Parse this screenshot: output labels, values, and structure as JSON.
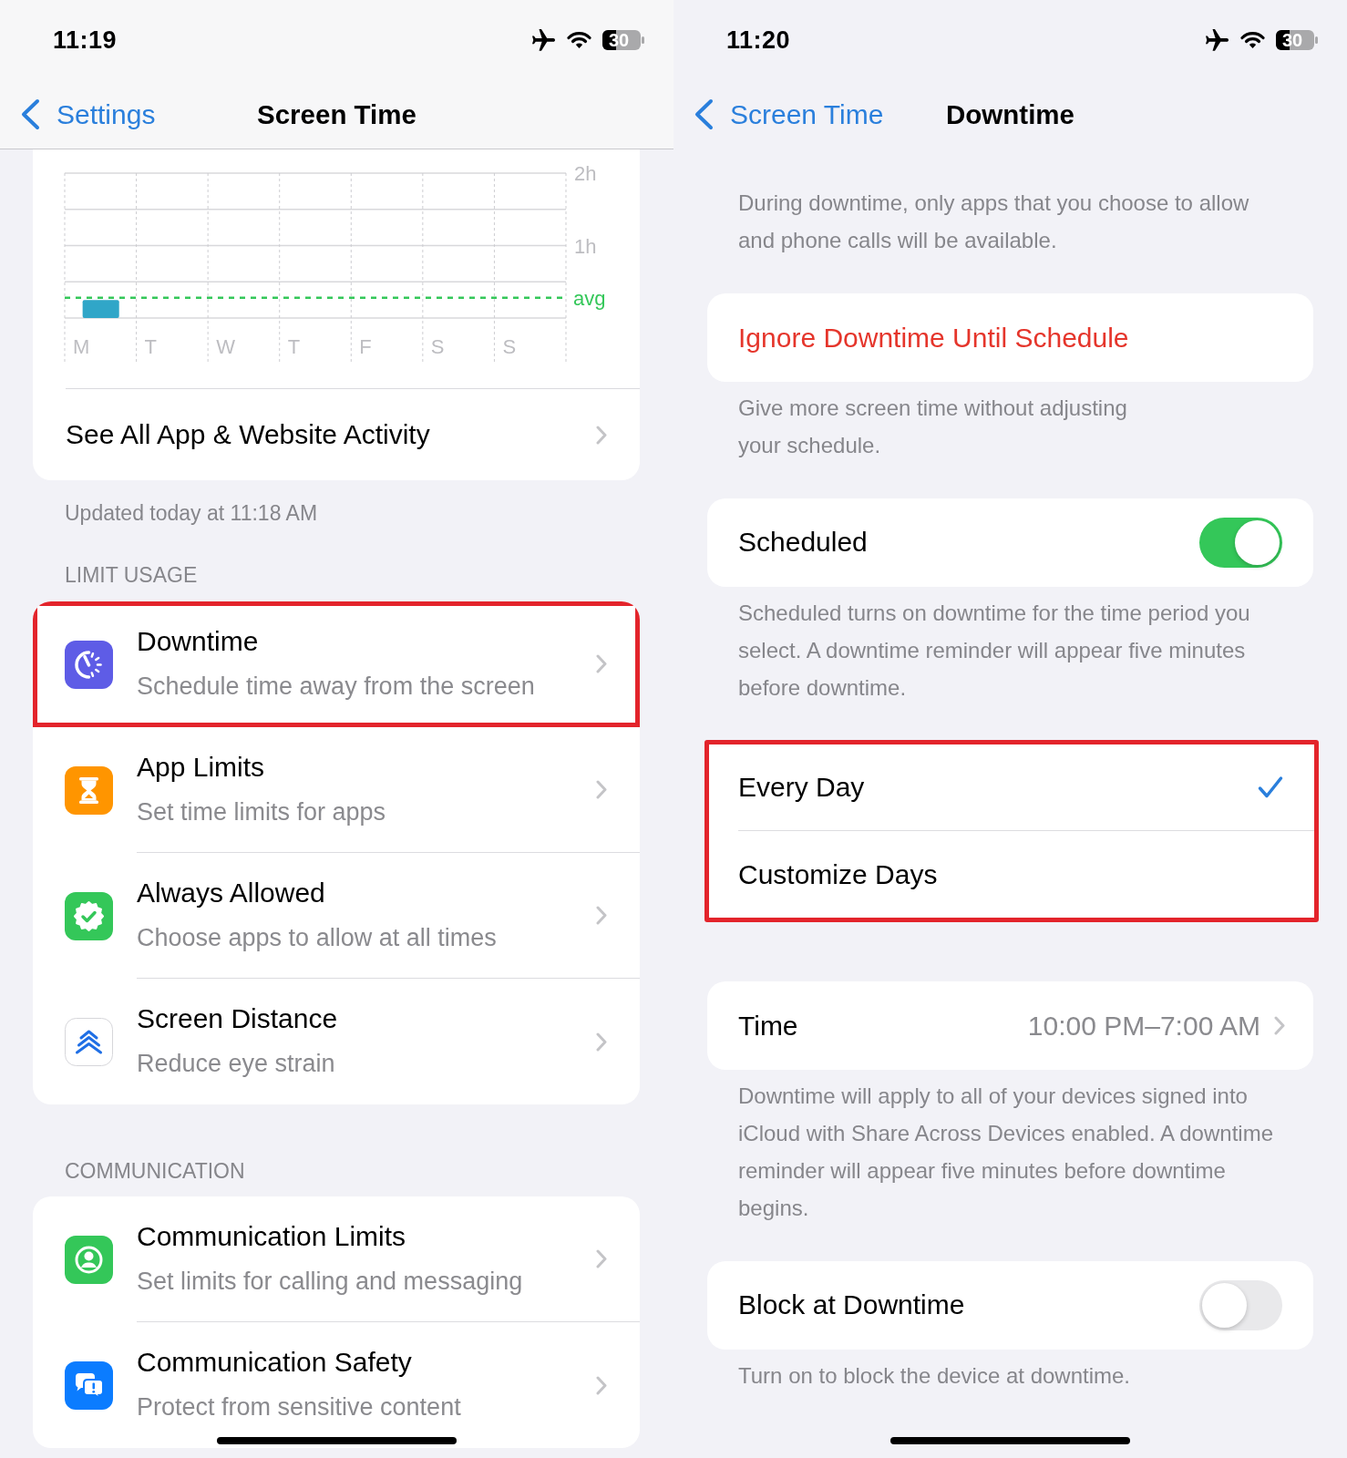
{
  "screen_time_page": {
    "status_bar": {
      "time": "11:19",
      "battery": "30"
    },
    "nav_bar": {
      "back": "Settings",
      "title": "Screen Time"
    },
    "activity_card": {
      "chart_data": {
        "type": "bar",
        "categories": [
          "M",
          "T",
          "W",
          "T",
          "F",
          "S",
          "S"
        ],
        "values": [
          0.25,
          null,
          null,
          null,
          null,
          null,
          null
        ],
        "ylim": [
          0,
          2
        ],
        "yticks": [
          {
            "value": 1,
            "label": "1h"
          },
          {
            "value": 2,
            "label": "2h"
          }
        ],
        "ref_lines": [
          {
            "axis": "y",
            "value": 0.28,
            "label": "avg"
          }
        ]
      },
      "link": "See All App & Website Activity"
    },
    "updated_note": "Updated today at 11:18 AM",
    "sections": [
      {
        "header": "LIMIT USAGE",
        "rows": [
          {
            "title": "Downtime",
            "subtitle": "Schedule time away from the screen",
            "highlighted": true
          },
          {
            "title": "App Limits",
            "subtitle": "Set time limits for apps",
            "highlighted": false
          },
          {
            "title": "Always Allowed",
            "subtitle": "Choose apps to allow at all times",
            "highlighted": false
          },
          {
            "title": "Screen Distance",
            "subtitle": "Reduce eye strain",
            "highlighted": false
          }
        ]
      },
      {
        "header": "COMMUNICATION",
        "rows": [
          {
            "title": "Communication Limits",
            "subtitle": "Set limits for calling and messaging",
            "highlighted": false
          },
          {
            "title": "Communication Safety",
            "subtitle": "Protect from sensitive content",
            "highlighted": false
          }
        ]
      }
    ]
  },
  "downtime_page": {
    "status_bar": {
      "time": "11:20",
      "battery": "30"
    },
    "nav_bar": {
      "back": "Screen Time",
      "title": "Downtime"
    },
    "intro": "During downtime, only apps that you choose to allow and phone calls will be available.",
    "sections": [
      {
        "highlighted": false,
        "rows": [
          {
            "kind": "action",
            "label": "Ignore Downtime Until Schedule"
          }
        ],
        "footer": "Give more screen time without adjusting\nyour schedule."
      },
      {
        "highlighted": false,
        "rows": [
          {
            "kind": "toggle",
            "label": "Scheduled",
            "on": true
          }
        ],
        "footer": "Scheduled turns on downtime for the time period you select. A downtime reminder will appear five minutes before downtime."
      },
      {
        "highlighted": true,
        "rows": [
          {
            "kind": "option",
            "label": "Every Day",
            "selected": true
          },
          {
            "kind": "option",
            "label": "Customize Days",
            "selected": false
          }
        ]
      },
      {
        "highlighted": false,
        "rows": [
          {
            "kind": "value",
            "label": "Time",
            "value": "10:00 PM–7:00 AM"
          }
        ],
        "footer": "Downtime will apply to all of your devices signed into iCloud with Share Across Devices enabled. A downtime reminder will appear five minutes before downtime begins."
      },
      {
        "highlighted": false,
        "rows": [
          {
            "kind": "toggle",
            "label": "Block at Downtime",
            "on": false
          }
        ],
        "footer": "Turn on to block the device at downtime."
      }
    ]
  }
}
